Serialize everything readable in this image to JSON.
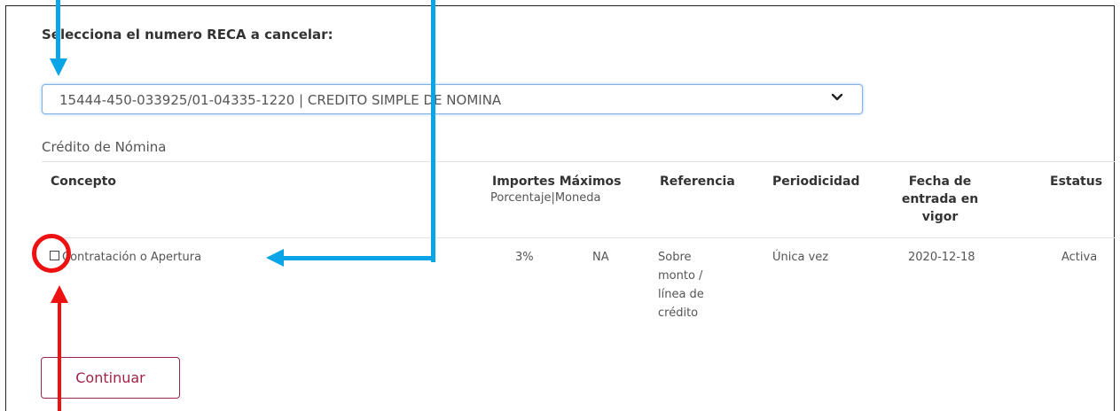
{
  "page": {
    "title": "Selecciona el numero RECA a cancelar:",
    "select": {
      "value": "15444-450-033925/01-04335-1220 | CREDITO SIMPLE DE NOMINA",
      "icon": "chevron-down-icon"
    },
    "section_title": "Crédito de Nómina",
    "table": {
      "headers": {
        "concepto": "Concepto",
        "importes": "Importes Máximos",
        "importes_sub": "Porcentaje|Moneda",
        "referencia": "Referencia",
        "periodicidad": "Periodicidad",
        "fecha": "Fecha de entrada en vigor",
        "estatus": "Estatus"
      },
      "rows": [
        {
          "concepto": "Contratación o Apertura",
          "porcentaje": "3%",
          "moneda": "NA",
          "referencia": "Sobre monto / línea de crédito",
          "periodicidad": "Única vez",
          "fecha": "2020-12-18",
          "estatus": "Activa",
          "checked": false
        }
      ]
    },
    "continue_label": "Continuar"
  },
  "annotations": {
    "arrow_color": "#0aa5e6",
    "highlight_color": "#ee1111"
  }
}
